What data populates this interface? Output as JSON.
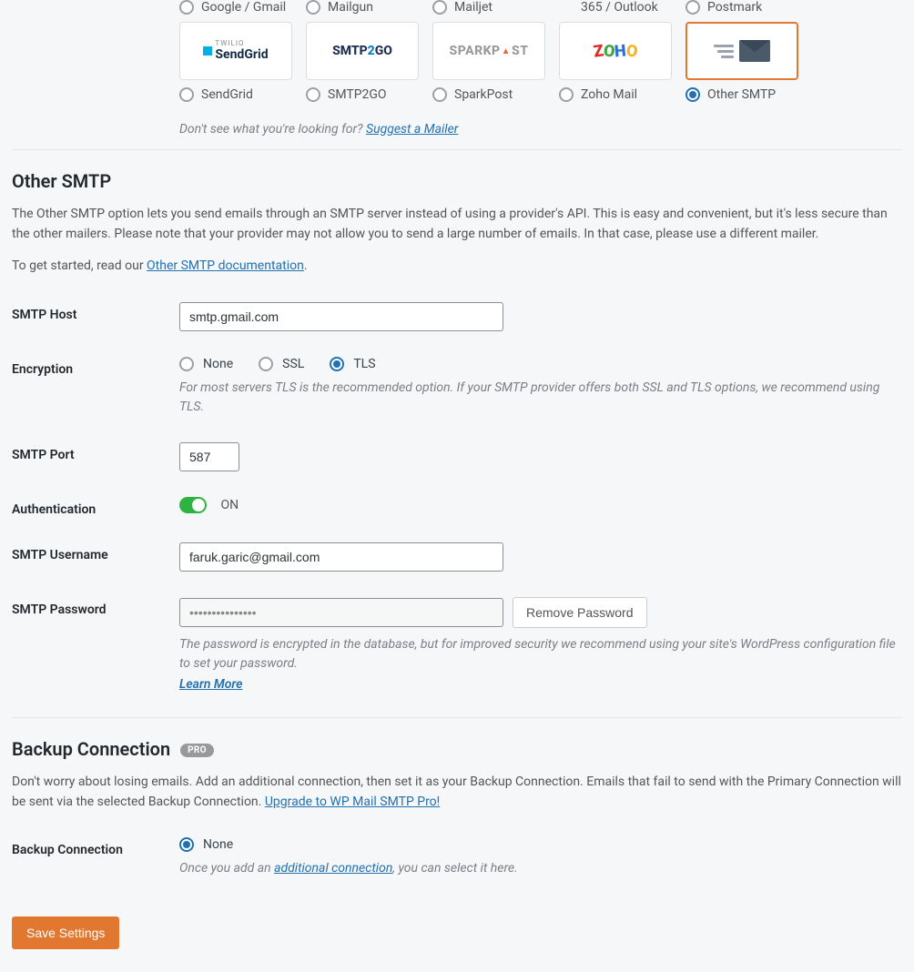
{
  "mailers_top": [
    {
      "label": "Google / Gmail"
    },
    {
      "label": "Mailgun"
    },
    {
      "label": "Mailjet"
    },
    {
      "label": "365 / Outlook"
    },
    {
      "label": "Postmark"
    }
  ],
  "mailers": [
    {
      "id": "sendgrid",
      "label": "SendGrid"
    },
    {
      "id": "smtp2go",
      "label": "SMTP2GO"
    },
    {
      "id": "sparkpost",
      "label": "SparkPost"
    },
    {
      "id": "zoho",
      "label": "Zoho Mail"
    },
    {
      "id": "other",
      "label": "Other SMTP",
      "selected": true
    }
  ],
  "suggest_prefix": "Don't see what you're looking for? ",
  "suggest_link": "Suggest a Mailer",
  "section_title": "Other SMTP",
  "section_desc": "The Other SMTP option lets you send emails through an SMTP server instead of using a provider's API. This is easy and convenient, but it's less secure than the other mailers. Please note that your provider may not allow you to send a large number of emails. In that case, please use a different mailer.",
  "get_started_prefix": "To get started, read our ",
  "get_started_link": "Other SMTP documentation",
  "fields": {
    "host_label": "SMTP Host",
    "host_value": "smtp.gmail.com",
    "enc_label": "Encryption",
    "enc_options": {
      "none": "None",
      "ssl": "SSL",
      "tls": "TLS"
    },
    "enc_hint": "For most servers TLS is the recommended option. If your SMTP provider offers both SSL and TLS options, we recommend using TLS.",
    "port_label": "SMTP Port",
    "port_value": "587",
    "auth_label": "Authentication",
    "auth_on": "ON",
    "user_label": "SMTP Username",
    "user_value": "faruk.garic@gmail.com",
    "pass_label": "SMTP Password",
    "pass_value": "•••••••••••••••",
    "remove_btn": "Remove Password",
    "pass_hint": "The password is encrypted in the database, but for improved security we recommend using your site's WordPress configuration file to set your password.",
    "learn_more": "Learn More"
  },
  "backup": {
    "title": "Backup Connection",
    "badge": "PRO",
    "desc_prefix": "Don't worry about losing emails. Add an additional connection, then set it as your Backup Connection. Emails that fail to send with the Primary Connection will be sent via the selected Backup Connection. ",
    "upgrade_link": "Upgrade to WP Mail SMTP Pro!",
    "conn_label": "Backup Connection",
    "none": "None",
    "hint_prefix": "Once you add an ",
    "hint_link": "additional connection",
    "hint_suffix": ", you can select it here."
  },
  "save": "Save Settings"
}
